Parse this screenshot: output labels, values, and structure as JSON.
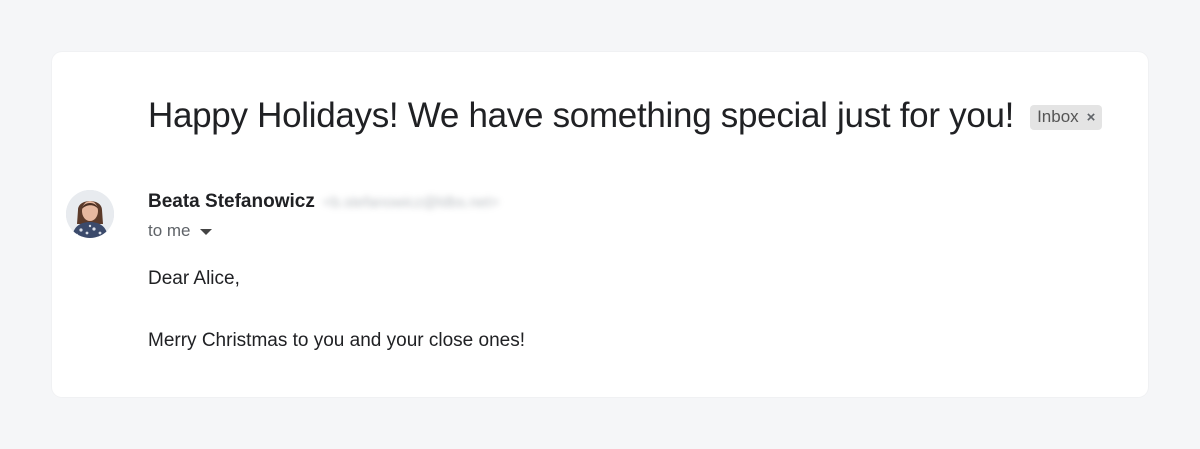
{
  "email": {
    "subject": "Happy Holidays! We have something special just for you!",
    "label": "Inbox",
    "label_remove": "×",
    "sender_name": "Beata Stefanowicz",
    "sender_email": "<b.stefanowicz@ldbs.net>",
    "recipient": "to me",
    "body": [
      "Dear Alice,",
      "Merry Christmas to you and your close ones!"
    ]
  },
  "colors": {
    "page_background": "#f5f6f8",
    "card_background": "#ffffff",
    "chip_background": "#e4e4e4",
    "text_primary": "#202124",
    "text_secondary": "#5f6368"
  },
  "icons": [
    "sender-avatar",
    "dropdown-caret-icon",
    "remove-label-icon"
  ]
}
